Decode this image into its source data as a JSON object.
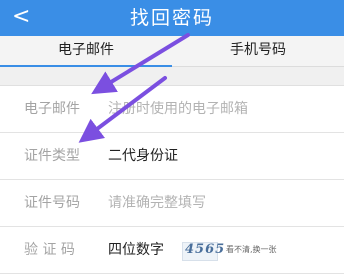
{
  "header": {
    "back_icon": "chevron-left-icon",
    "back_glyph": "<",
    "title": "找回密码",
    "background": "#3a8ee6"
  },
  "tabs": [
    {
      "label": "电子邮件",
      "active": true
    },
    {
      "label": "手机号码",
      "active": false
    }
  ],
  "form": {
    "email": {
      "label": "电子邮件",
      "placeholder": "注册时使用的电子邮箱"
    },
    "id_type": {
      "label": "证件类型",
      "value": "二代身份证"
    },
    "id_number": {
      "label": "证件号码",
      "placeholder": "请准确完整填写"
    },
    "captcha": {
      "label": "验 证 码",
      "placeholder": "四位数字",
      "image_text": "4565",
      "refresh_label": "看不清,换一张"
    }
  },
  "annotations": {
    "arrow_color": "#7b4fe0"
  }
}
